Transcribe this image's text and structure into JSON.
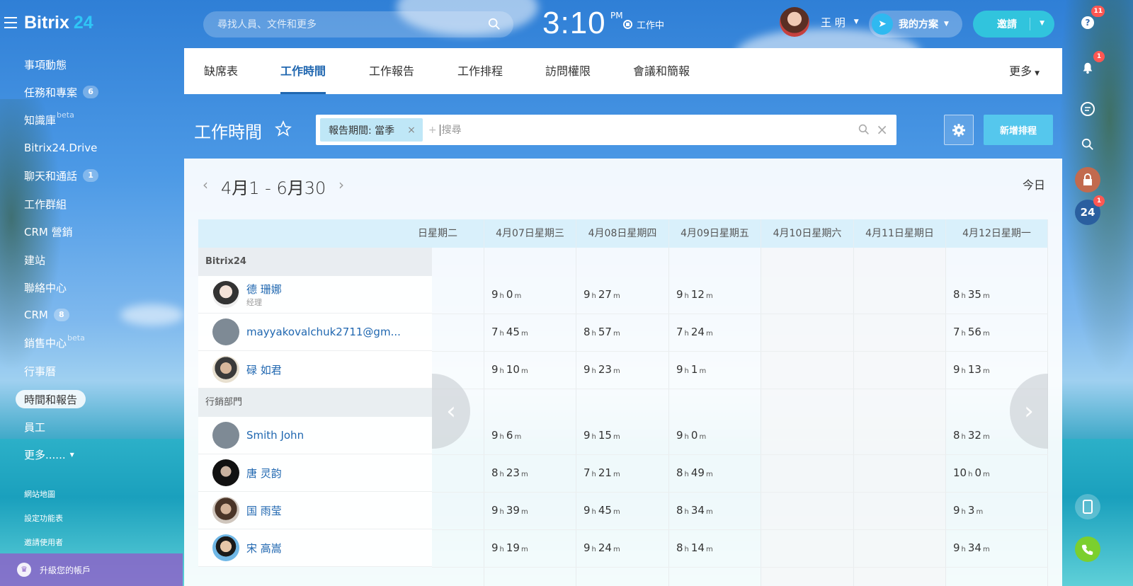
{
  "topbar": {
    "logo_text": "Bitrix",
    "logo_num": "24",
    "search_placeholder": "尋找人員、文件和更多",
    "clock_time": "3:10",
    "clock_ampm": "PM",
    "work_status": "工作中",
    "user_name": "王 明",
    "plan_label": "我的方案",
    "invite_label": "邀請"
  },
  "leftnav": {
    "items": [
      {
        "label": "事項動態",
        "badge": ""
      },
      {
        "label": "任務和專案",
        "badge": "6"
      },
      {
        "label": "知識庫",
        "sup": "beta"
      },
      {
        "label": "Bitrix24.Drive",
        "badge": ""
      },
      {
        "label": "聊天和通話",
        "badge": "1"
      },
      {
        "label": "工作群組",
        "badge": ""
      },
      {
        "label": "CRM 營銷",
        "badge": ""
      },
      {
        "label": "建站",
        "badge": ""
      },
      {
        "label": "聯絡中心",
        "badge": ""
      },
      {
        "label": "CRM",
        "badge": "8"
      },
      {
        "label": "銷售中心",
        "sup": "beta"
      },
      {
        "label": "行事曆",
        "badge": ""
      },
      {
        "label": "時間和報告",
        "badge": ""
      },
      {
        "label": "員工",
        "badge": ""
      },
      {
        "label": "更多......",
        "badge": ""
      }
    ],
    "small_links": [
      "網站地圖",
      "設定功能表",
      "邀請使用者"
    ],
    "upgrade_label": "升級您的帳戶"
  },
  "rightrail": {
    "help_badge": "11",
    "bell_badge": "1",
    "b24_badge": "1",
    "b24_label": "24"
  },
  "tabs": {
    "items": [
      "缺席表",
      "工作時間",
      "工作報告",
      "工作排程",
      "訪問權限",
      "會議和簡報"
    ],
    "active_index": 1,
    "more_label": "更多"
  },
  "header": {
    "title": "工作時間",
    "filter_chip": "報告期間: 當季",
    "filter_placeholder": "搜尋",
    "new_button": "新增排程"
  },
  "range": {
    "label": "4月1 - 6月30",
    "today_label": "今日"
  },
  "grid": {
    "columns": [
      "日星期二",
      "4月07日星期三",
      "4月08日星期四",
      "4月09日星期五",
      "4月10日星期六",
      "4月11日星期日",
      "4月12日星期一"
    ],
    "weekend_columns": [
      4,
      5
    ],
    "groups": [
      {
        "name": "Bitrix24",
        "employees": [
          {
            "name": "德 珊娜",
            "role": "经理",
            "avatar": "photo-woman",
            "hours": [
              null,
              [
                "9",
                "0"
              ],
              [
                "9",
                "27"
              ],
              [
                "9",
                "12"
              ],
              null,
              null,
              [
                "8",
                "35"
              ]
            ]
          },
          {
            "name": "mayyakovalchuk2711@gm...",
            "role": "",
            "avatar": "placeholder",
            "hours": [
              null,
              [
                "7",
                "45"
              ],
              [
                "8",
                "57"
              ],
              [
                "7",
                "24"
              ],
              null,
              null,
              [
                "7",
                "56"
              ]
            ]
          },
          {
            "name": "碌 如君",
            "role": "",
            "avatar": "photo-man",
            "hours": [
              null,
              [
                "9",
                "10"
              ],
              [
                "9",
                "23"
              ],
              [
                "9",
                "1"
              ],
              null,
              null,
              [
                "9",
                "13"
              ]
            ]
          }
        ]
      },
      {
        "name": "行銷部門",
        "employees": [
          {
            "name": "Smith John",
            "role": "",
            "avatar": "placeholder",
            "hours": [
              null,
              [
                "9",
                "6"
              ],
              [
                "9",
                "15"
              ],
              [
                "9",
                "0"
              ],
              null,
              null,
              [
                "8",
                "32"
              ]
            ]
          },
          {
            "name": "唐 灵韵",
            "role": "",
            "avatar": "photo-woman-dark",
            "hours": [
              null,
              [
                "8",
                "23"
              ],
              [
                "7",
                "21"
              ],
              [
                "8",
                "49"
              ],
              null,
              null,
              [
                "10",
                "0"
              ]
            ]
          },
          {
            "name": "国 雨莹",
            "role": "",
            "avatar": "photo-woman-2",
            "hours": [
              null,
              [
                "9",
                "39"
              ],
              [
                "9",
                "45"
              ],
              [
                "8",
                "34"
              ],
              null,
              null,
              [
                "9",
                "3"
              ]
            ]
          },
          {
            "name": "宋 高嵩",
            "role": "",
            "avatar": "photo-man-2",
            "hours": [
              null,
              [
                "9",
                "19"
              ],
              [
                "9",
                "24"
              ],
              [
                "8",
                "14"
              ],
              null,
              null,
              [
                "9",
                "34"
              ]
            ]
          }
        ]
      }
    ],
    "hour_unit": "h",
    "minute_unit": "m"
  },
  "colors": {
    "accent": "#2067b0",
    "invite": "#31c4dd",
    "new_button": "#55c7ed",
    "badge_red": "#ff5752",
    "header_row": "#d9f0fb"
  }
}
